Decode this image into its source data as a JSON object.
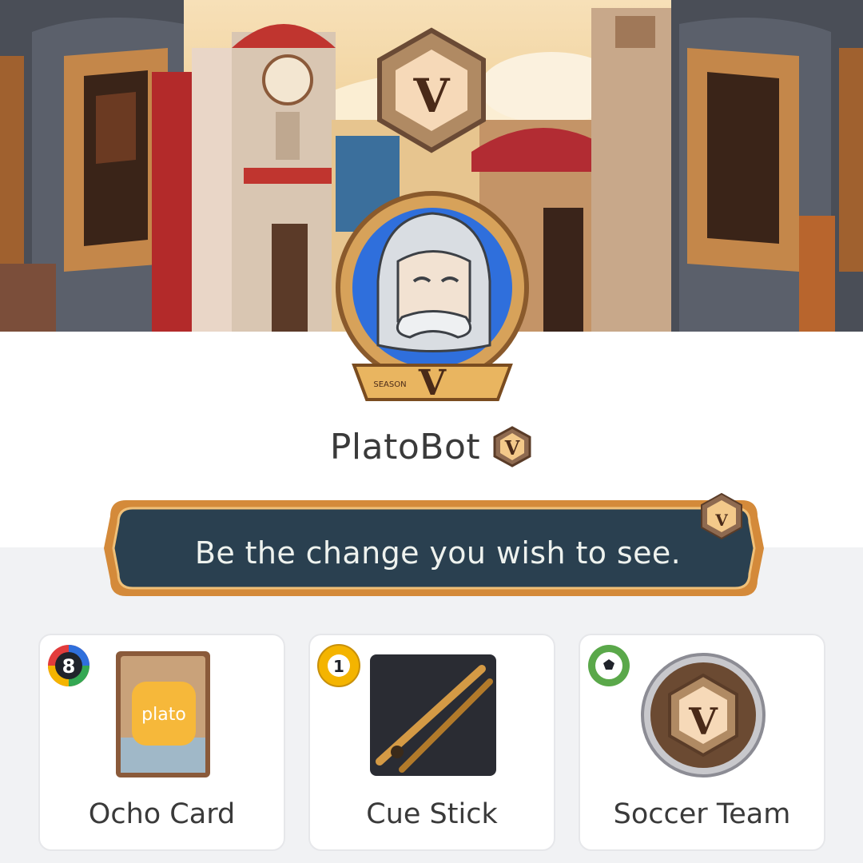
{
  "profile": {
    "username": "PlatoBot",
    "season_badge_letter": "V",
    "season_label": "SEASON",
    "status_quote": "Be the change you wish to see."
  },
  "items": [
    {
      "label": "Ocho Card",
      "game_icon": "ocho-8-badge-icon",
      "badge_text": "8",
      "art_text": "plato"
    },
    {
      "label": "Cue Stick",
      "game_icon": "billiard-1-ball-icon",
      "badge_text": "1"
    },
    {
      "label": "Soccer Team",
      "game_icon": "soccer-ball-icon"
    }
  ],
  "colors": {
    "page_bg": "#f1f2f4",
    "card_bg": "#ffffff",
    "text": "#3a3a3a",
    "quote_bg": "#2a4050",
    "quote_text": "#eef2ee",
    "gold": "#c58b3a",
    "avatar_blue": "#2f6fdc"
  }
}
